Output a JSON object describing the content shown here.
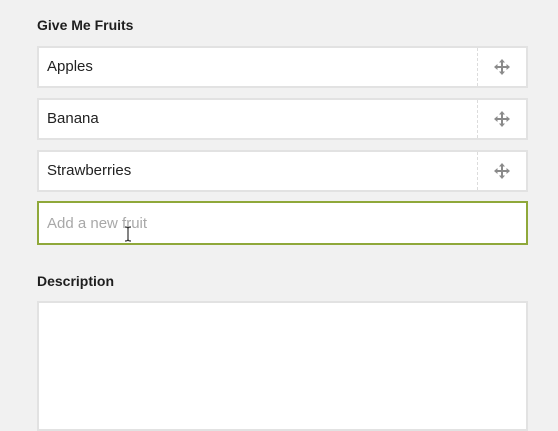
{
  "fruits_section": {
    "label": "Give Me Fruits",
    "items": [
      {
        "label": "Apples"
      },
      {
        "label": "Banana"
      },
      {
        "label": "Strawberries"
      }
    ],
    "new_item_placeholder": "Add a new fruit",
    "new_item_value": ""
  },
  "description_section": {
    "label": "Description",
    "value": ""
  },
  "colors": {
    "background": "#f1f1f1",
    "focus_border": "#8fa83a",
    "item_border": "#e2e2e2",
    "handle_icon": "#8a8a8a"
  },
  "icons": {
    "item_handle": "move-icon",
    "mouse_cursor": "text-cursor-icon"
  }
}
